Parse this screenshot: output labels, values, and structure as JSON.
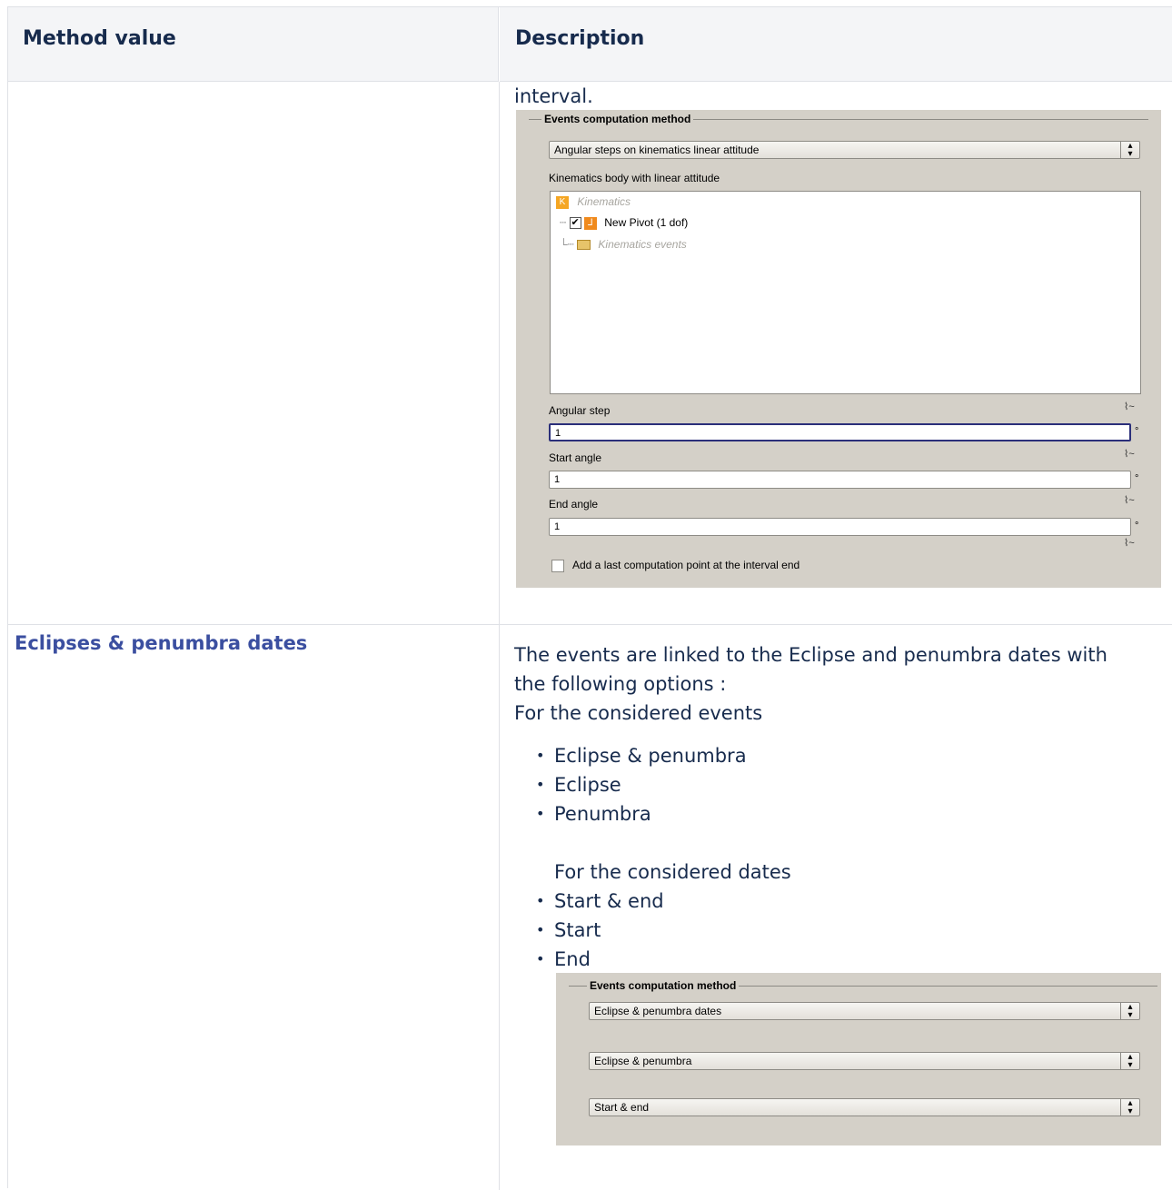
{
  "table": {
    "headers": [
      "Method value",
      "Description"
    ]
  },
  "row1": {
    "description_tail": "interval.",
    "panel": {
      "legend": "Events computation method",
      "method_select": "Angular steps on kinematics linear attitude",
      "tree_label": "Kinematics body with linear attitude",
      "tree": {
        "root": "Kinematics",
        "child": "New Pivot (1 dof)",
        "child_checked": true,
        "events_folder": "Kinematics events"
      },
      "angular_step": {
        "label": "Angular step",
        "value": "1",
        "unit": "°"
      },
      "start_angle": {
        "label": "Start angle",
        "value": "1",
        "unit": "°"
      },
      "end_angle": {
        "label": "End angle",
        "value": "1",
        "unit": "°"
      },
      "last_point_checkbox": "Add a last computation point at the interval end"
    }
  },
  "row2": {
    "method": "Eclipses & penumbra dates",
    "desc_line1": "The events are linked to the Eclipse and penumbra dates with",
    "desc_line2": "the following options :",
    "desc_line3": "For the considered events",
    "events_options": [
      "Eclipse & penumbra",
      "Eclipse",
      "Penumbra"
    ],
    "dates_heading": "For the considered dates",
    "dates_options": [
      "Start & end",
      "Start",
      "End"
    ],
    "panel": {
      "legend": "Events computation method",
      "method_select": "Eclipse & penumbra dates",
      "events_select": "Eclipse & penumbra",
      "dates_select": "Start & end"
    }
  }
}
